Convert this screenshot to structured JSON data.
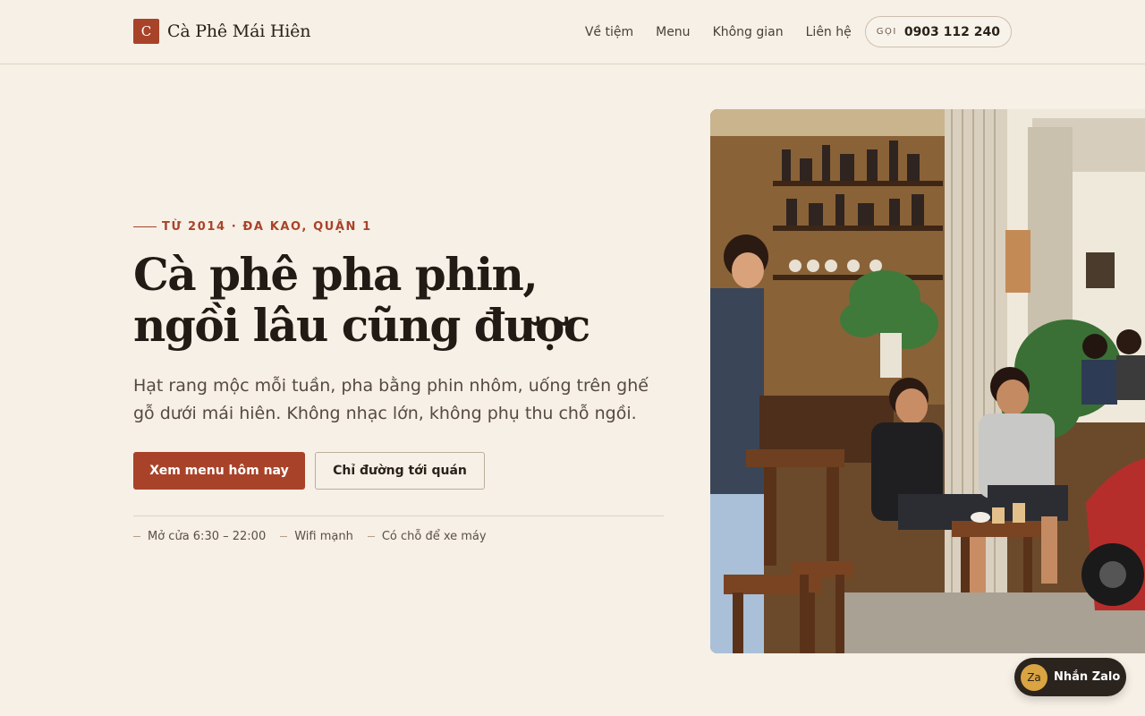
{
  "brand": {
    "mark": "C",
    "name": "Cà Phê Mái Hiên"
  },
  "nav": {
    "items": [
      "Về tiệm",
      "Menu",
      "Không gian",
      "Liên hệ"
    ],
    "call_label": "GỌI",
    "call_number": "0903 112 240"
  },
  "hero": {
    "eyebrow": "TỪ 2014 · ĐA KAO, QUẬN 1",
    "headline_line1": "Cà phê pha phin,",
    "headline_line2": "ngồi lâu cũng được",
    "lead_line1": "Hạt rang mộc mỗi tuần, pha bằng phin nhôm, uống trên ghế",
    "lead_line2": "gỗ dưới mái hiên. Không nhạc lớn, không phụ thu chỗ ngồi.",
    "primary_cta": "Xem menu hôm nay",
    "secondary_cta": "Chỉ đường tới quán",
    "features": [
      "Mở cửa 6:30 – 22:00",
      "Wifi mạnh",
      "Có chỗ để xe máy"
    ]
  },
  "floating": {
    "zalo_badge": "Za",
    "zalo_label": "Nhắn Zalo"
  },
  "colors": {
    "accent": "#a8432a",
    "background": "#f6f0e6",
    "ink": "#2a211b"
  }
}
